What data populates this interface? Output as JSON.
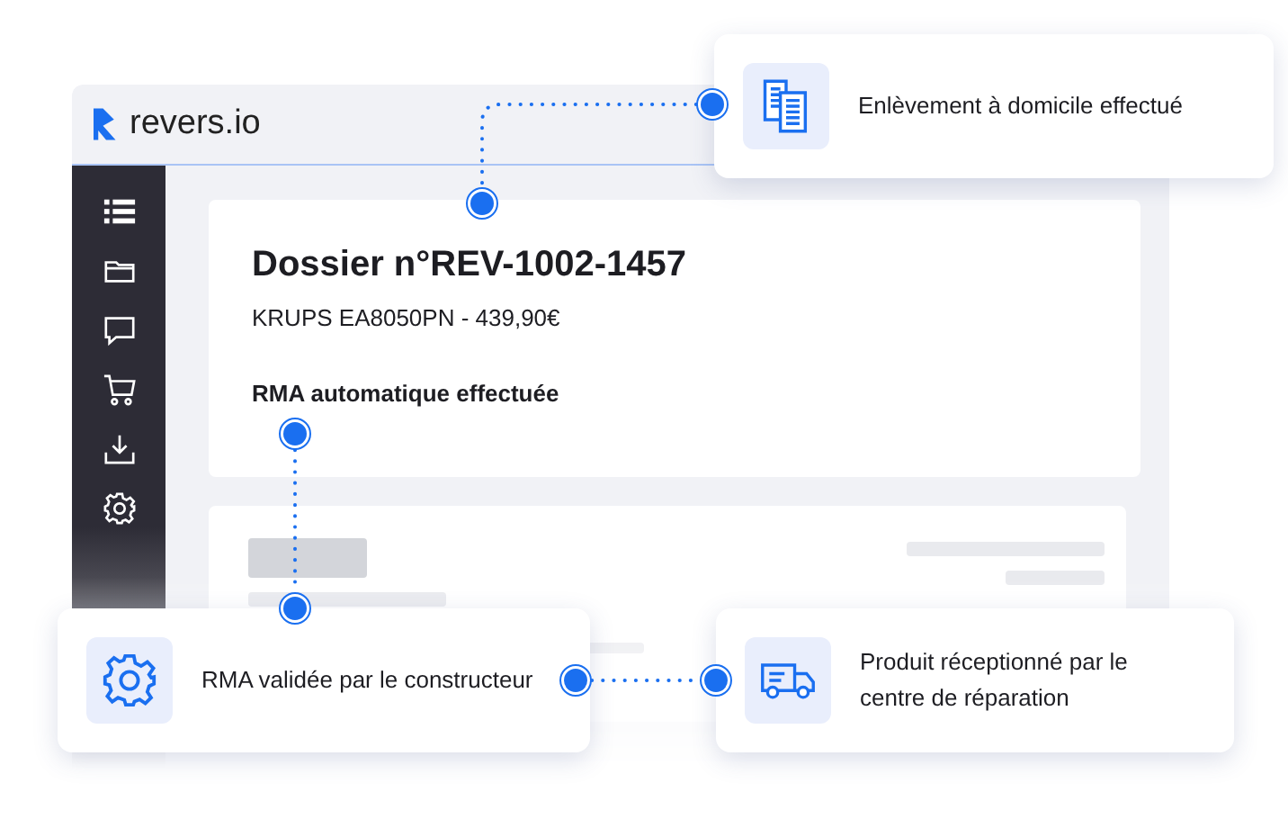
{
  "app": {
    "logo": "revers.io",
    "sidebar": [
      {
        "kind": "list"
      },
      {
        "kind": "folder"
      },
      {
        "kind": "chat"
      },
      {
        "kind": "cart"
      },
      {
        "kind": "download"
      },
      {
        "kind": "settings"
      }
    ],
    "case": {
      "title": "Dossier n°REV-1002-1457",
      "product": "KRUPS EA8050PN - 439,90€",
      "status": "RMA automatique effectuée"
    }
  },
  "steps": [
    {
      "kind": "documents",
      "text": "Enlèvement à domicile effectué"
    },
    {
      "kind": "gear",
      "text": "RMA validée par le constructeur"
    },
    {
      "kind": "truck",
      "text": "Produit réceptionné par le centre de réparation"
    }
  ]
}
